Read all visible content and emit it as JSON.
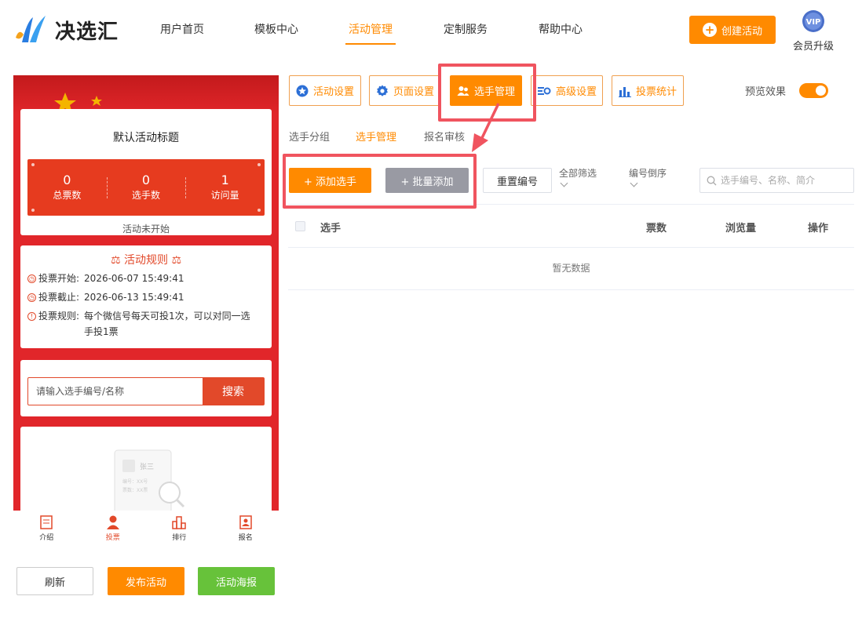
{
  "header": {
    "logo_text": "决选汇",
    "nav": [
      {
        "label": "用户首页",
        "active": false
      },
      {
        "label": "模板中心",
        "active": false
      },
      {
        "label": "活动管理",
        "active": true
      },
      {
        "label": "定制服务",
        "active": false
      },
      {
        "label": "帮助中心",
        "active": false
      }
    ],
    "create_button": "创建活动",
    "vip_badge": "VIP",
    "vip_label": "会员升级"
  },
  "preview": {
    "activity_title": "默认活动标题",
    "stats": [
      {
        "value": "0",
        "label": "总票数"
      },
      {
        "value": "0",
        "label": "选手数"
      },
      {
        "value": "1",
        "label": "访问量"
      }
    ],
    "status": "活动未开始",
    "rules_title": "活动规则",
    "rules": [
      {
        "label": "投票开始:",
        "value": "2026-06-07 15:49:41"
      },
      {
        "label": "投票截止:",
        "value": "2026-06-13 15:49:41"
      },
      {
        "label": "投票规则:",
        "value": "每个微信号每天可投1次，可以对同一选手投1票"
      }
    ],
    "search_placeholder": "请输入选手编号/名称",
    "search_button": "搜索",
    "placeholder_card": {
      "name": "张三",
      "line1": "编号：XX号",
      "line2": "票数：XX票"
    },
    "tabbar": [
      {
        "label": "介绍",
        "icon": "doc-icon",
        "active": false
      },
      {
        "label": "投票",
        "icon": "user-icon",
        "active": true
      },
      {
        "label": "排行",
        "icon": "ranking-icon",
        "active": false
      },
      {
        "label": "报名",
        "icon": "signup-icon",
        "active": false
      }
    ]
  },
  "bottom_actions": {
    "refresh": "刷新",
    "publish": "发布活动",
    "poster": "活动海报"
  },
  "toolbar": {
    "tabs": [
      {
        "label": "活动设置",
        "icon": "star-icon",
        "active": false
      },
      {
        "label": "页面设置",
        "icon": "gear-icon",
        "active": false
      },
      {
        "label": "选手管理",
        "icon": "users-icon",
        "active": true
      },
      {
        "label": "高级设置",
        "icon": "advanced-settings-icon",
        "active": false
      },
      {
        "label": "投票统计",
        "icon": "bar-chart-icon",
        "active": false
      }
    ],
    "preview_label": "预览效果",
    "preview_enabled": true
  },
  "subtabs": [
    {
      "label": "选手分组",
      "active": false
    },
    {
      "label": "选手管理",
      "active": true
    },
    {
      "label": "报名审核",
      "active": false
    }
  ],
  "actions": {
    "add_player": "+ 添加选手",
    "batch_add": "+ 批量添加",
    "reset_number": "重置编号",
    "filter_all": "全部筛选",
    "sort_number": "编号倒序",
    "search_placeholder": "选手编号、名称、简介"
  },
  "table": {
    "columns": [
      "选手",
      "票数",
      "浏览量",
      "操作"
    ],
    "empty_text": "暂无数据"
  },
  "colors": {
    "accent": "#ff8a00",
    "preview_red": "#e1262a",
    "highlight": "#f0545f",
    "poster_green": "#67c23a"
  }
}
